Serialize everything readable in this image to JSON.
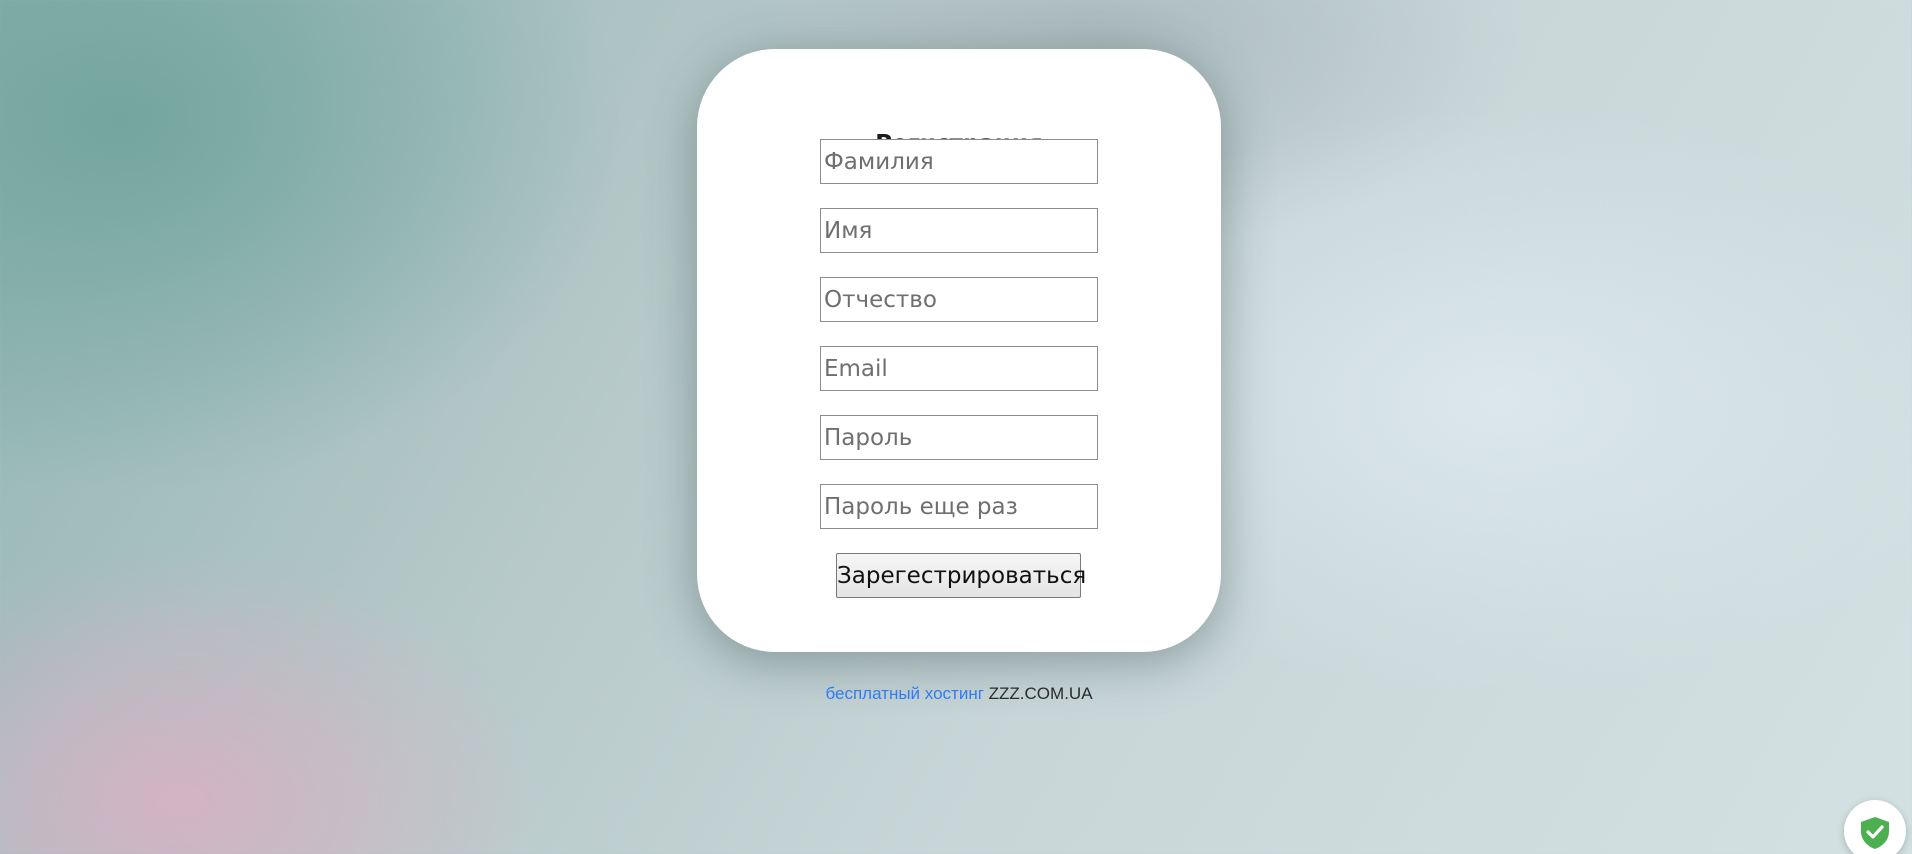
{
  "form": {
    "title": "Регистрация",
    "fields": [
      {
        "placeholder": "Фамилия"
      },
      {
        "placeholder": "Имя"
      },
      {
        "placeholder": "Отчество"
      },
      {
        "placeholder": "Email"
      },
      {
        "placeholder": "Пароль"
      },
      {
        "placeholder": "Пароль еще раз"
      }
    ],
    "submit_label": "Зарегестрироваться"
  },
  "footer": {
    "link_text": "бесплатный хостинг",
    "brand_text": "ZZZ.COM.UA"
  },
  "widgets": {
    "shield_icon": "shield-check-icon",
    "shield_color": "#4caf50"
  }
}
